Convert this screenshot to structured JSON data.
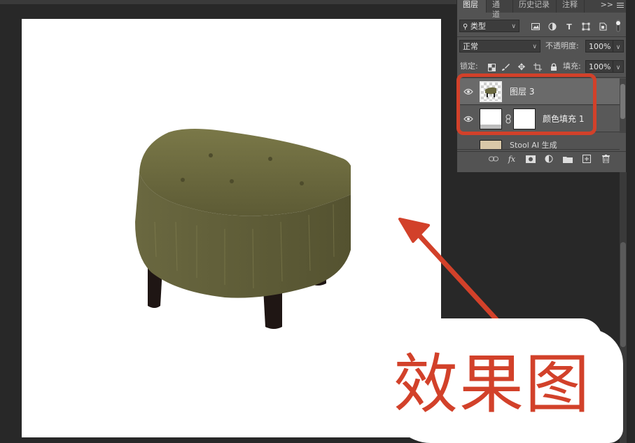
{
  "panel": {
    "tabs": [
      "图层",
      "通道",
      "历史记录",
      "注释"
    ],
    "more_symbol": ">>",
    "filter_label": "类型",
    "blend_mode": "正常",
    "opacity_label": "不透明度:",
    "opacity_value": "100%",
    "lock_label": "锁定:",
    "fill_label": "填充:",
    "fill_value": "100%",
    "layers": [
      {
        "name": "图层 3",
        "selected": true
      },
      {
        "name": "颜色填充 1",
        "selected": false
      },
      {
        "name": "Stool AI 生成",
        "selected": false
      }
    ],
    "bottom_icons": [
      "link-icon",
      "fx-icon",
      "mask-icon",
      "adjustment-icon",
      "folder-icon",
      "new-layer-icon",
      "trash-icon"
    ],
    "fx_label": "fx"
  },
  "caption": "效果图",
  "colors": {
    "accent": "#d2412a",
    "panel": "#535353",
    "workspace": "#282828"
  }
}
